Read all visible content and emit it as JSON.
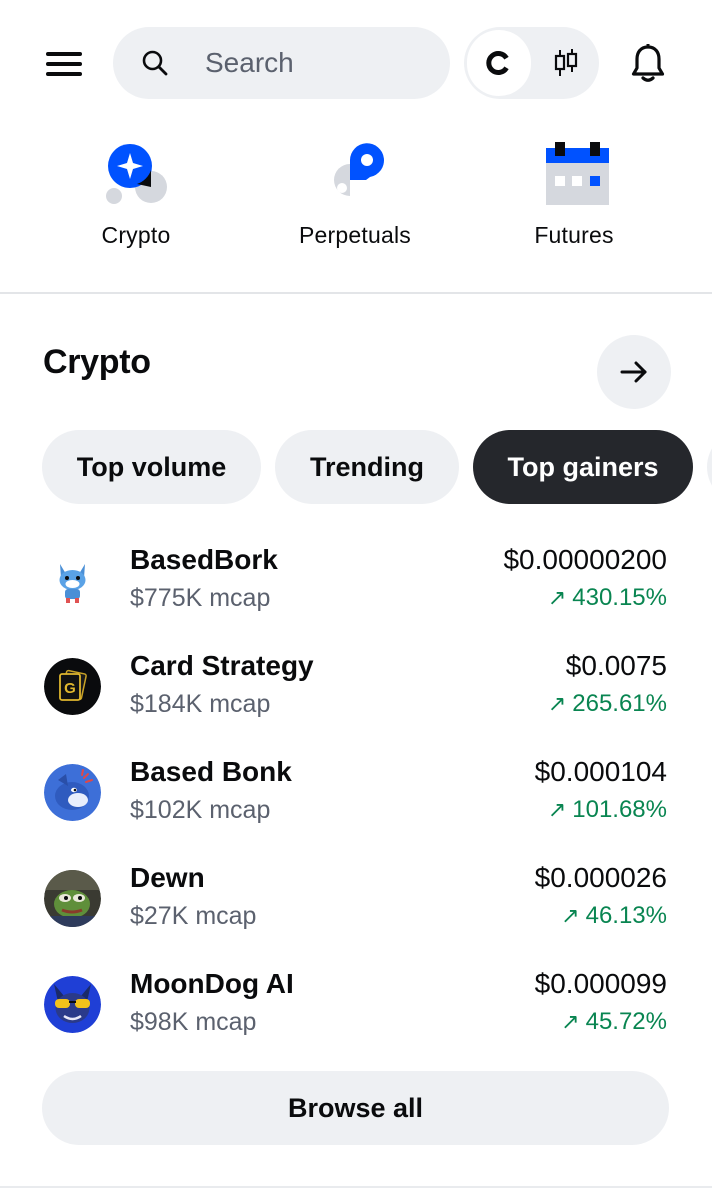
{
  "header": {
    "menu_icon": "hamburger-menu-icon",
    "search": {
      "placeholder": "Search",
      "icon": "search-icon"
    },
    "mode_toggle": {
      "active_icon": "coinbase-logo-icon",
      "alt_icon": "candlestick-chart-icon"
    },
    "notifications_icon": "bell-icon"
  },
  "categories": [
    {
      "label": "Crypto",
      "icon": "crypto-sparkle-icon"
    },
    {
      "label": "Perpetuals",
      "icon": "perpetuals-icon"
    },
    {
      "label": "Futures",
      "icon": "futures-calendar-icon"
    }
  ],
  "section": {
    "title": "Crypto",
    "arrow_icon": "arrow-right-icon",
    "chips": [
      {
        "label": "Top volume",
        "active": false
      },
      {
        "label": "Trending",
        "active": false
      },
      {
        "label": "Top gainers",
        "active": true
      }
    ]
  },
  "assets": [
    {
      "name": "BasedBork",
      "mcap": "$775K mcap",
      "price": "$0.00000200",
      "change": "430.15%",
      "avatar": "basedbork-avatar"
    },
    {
      "name": "Card Strategy",
      "mcap": "$184K mcap",
      "price": "$0.0075",
      "change": "265.61%",
      "avatar": "card-strategy-avatar"
    },
    {
      "name": "Based Bonk",
      "mcap": "$102K mcap",
      "price": "$0.000104",
      "change": "101.68%",
      "avatar": "based-bonk-avatar"
    },
    {
      "name": "Dewn",
      "mcap": "$27K mcap",
      "price": "$0.000026",
      "change": "46.13%",
      "avatar": "dewn-avatar"
    },
    {
      "name": "MoonDog AI",
      "mcap": "$98K mcap",
      "price": "$0.000099",
      "change": "45.72%",
      "avatar": "moondog-ai-avatar"
    }
  ],
  "browse_all": "Browse all",
  "colors": {
    "positive": "#098551",
    "brand_blue": "#0052ff",
    "chip_active_bg": "#25272c",
    "surface": "#eef0f3"
  }
}
